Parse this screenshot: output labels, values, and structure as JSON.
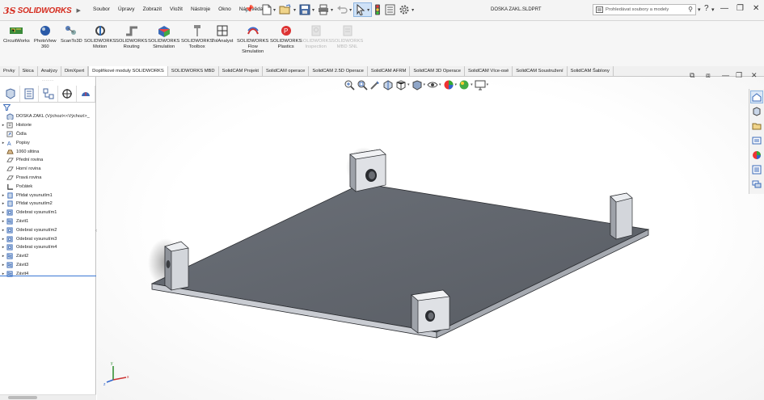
{
  "app": {
    "logo_prefix": "3S",
    "logo_text": "SOLIDWORKS",
    "document_title": "DOSKA ZAKL.SLDPRT"
  },
  "menu": [
    "Soubor",
    "Úpravy",
    "Zobrazit",
    "Vložit",
    "Nástroje",
    "Okno",
    "Nápověda"
  ],
  "search": {
    "placeholder": "Prohledávat soubory a modely"
  },
  "ribbon": [
    {
      "label": "CircuitWorks",
      "icon": "circuitworks-icon",
      "enabled": true
    },
    {
      "label": "PhotoView\n360",
      "icon": "photoview-icon",
      "enabled": true
    },
    {
      "label": "ScanTo3D",
      "icon": "scanto3d-icon",
      "enabled": true
    },
    {
      "label": "SOLIDWORKS\nMotion",
      "icon": "motion-icon",
      "enabled": true
    },
    {
      "label": "SOLIDWORKS\nRouting",
      "icon": "routing-icon",
      "enabled": true
    },
    {
      "label": "SOLIDWORKS\nSimulation",
      "icon": "simulation-icon",
      "enabled": true
    },
    {
      "label": "SOLIDWORKS\nToolbox",
      "icon": "toolbox-icon",
      "enabled": true
    },
    {
      "label": "TolAnalyst",
      "icon": "tolanalyst-icon",
      "enabled": true
    },
    {
      "label": "SOLIDWORKS\nFlow\nSimulation",
      "icon": "flow-simulation-icon",
      "enabled": true
    },
    {
      "label": "SOLIDWORKS\nPlastics",
      "icon": "plastics-icon",
      "enabled": true
    },
    {
      "label": "SOLIDWORKS\nInspection",
      "icon": "inspection-icon",
      "enabled": false
    },
    {
      "label": "SOLIDWORKS\nMBD SNL",
      "icon": "mbd-snl-icon",
      "enabled": false
    }
  ],
  "tabs": [
    {
      "label": "Prvky",
      "active": false
    },
    {
      "label": "Skica",
      "active": false
    },
    {
      "label": "Analýzy",
      "active": false
    },
    {
      "label": "DimXpert",
      "active": false
    },
    {
      "label": "Doplňkové moduly SOLIDWORKS",
      "active": true
    },
    {
      "label": "SOLIDWORKS MBD",
      "active": false
    },
    {
      "label": "SolidCAM Projekt",
      "active": false
    },
    {
      "label": "SolidCAM operace",
      "active": false
    },
    {
      "label": "SolidCAM 2.5D Operace",
      "active": false
    },
    {
      "label": "SolidCAM AFRM",
      "active": false
    },
    {
      "label": "SolidCAM 3D Operace",
      "active": false
    },
    {
      "label": "SolidCAM Více-osé",
      "active": false
    },
    {
      "label": "SolidCAM Soustružení",
      "active": false
    },
    {
      "label": "SolidCAM Šablony",
      "active": false
    }
  ],
  "tree": [
    {
      "label": "DOSKA ZAKL  (Výchozí<<Výchozí>_",
      "icon": "part-icon",
      "expander": "",
      "indent": 0
    },
    {
      "label": "Historie",
      "icon": "history-icon",
      "expander": "▸",
      "indent": 1
    },
    {
      "label": "Čidla",
      "icon": "sensors-icon",
      "expander": "",
      "indent": 1
    },
    {
      "label": "Popisy",
      "icon": "annotations-icon",
      "expander": "▸",
      "indent": 1
    },
    {
      "label": "1060 slitina",
      "icon": "material-icon",
      "expander": "",
      "indent": 1
    },
    {
      "label": "Přední rovina",
      "icon": "plane-icon",
      "expander": "",
      "indent": 1
    },
    {
      "label": "Horní rovina",
      "icon": "plane-icon",
      "expander": "",
      "indent": 1
    },
    {
      "label": "Pravá rovina",
      "icon": "plane-icon",
      "expander": "",
      "indent": 1
    },
    {
      "label": "Počátek",
      "icon": "origin-icon",
      "expander": "",
      "indent": 1
    },
    {
      "label": "Přidat vysunutím1",
      "icon": "extrude-icon",
      "expander": "▸",
      "indent": 1
    },
    {
      "label": "Přidat vysunutím2",
      "icon": "extrude-icon",
      "expander": "▸",
      "indent": 1
    },
    {
      "label": "Odebrat vysunutím1",
      "icon": "cut-extrude-icon",
      "expander": "▸",
      "indent": 1
    },
    {
      "label": "Závit1",
      "icon": "thread-icon",
      "expander": "▸",
      "indent": 1
    },
    {
      "label": "Odebrat vysunutím2",
      "icon": "cut-extrude-icon",
      "expander": "▸",
      "indent": 1
    },
    {
      "label": "Odebrat vysunutím3",
      "icon": "cut-extrude-icon",
      "expander": "▸",
      "indent": 1
    },
    {
      "label": "Odebrat vysunutím4",
      "icon": "cut-extrude-icon",
      "expander": "▸",
      "indent": 1
    },
    {
      "label": "Závit2",
      "icon": "thread-icon",
      "expander": "▸",
      "indent": 1
    },
    {
      "label": "Závit3",
      "icon": "thread-icon",
      "expander": "▸",
      "indent": 1
    },
    {
      "label": "Závit4",
      "icon": "thread-icon",
      "expander": "▸",
      "indent": 1
    }
  ],
  "triad": {
    "x": "x",
    "y": "y",
    "z": "z"
  }
}
